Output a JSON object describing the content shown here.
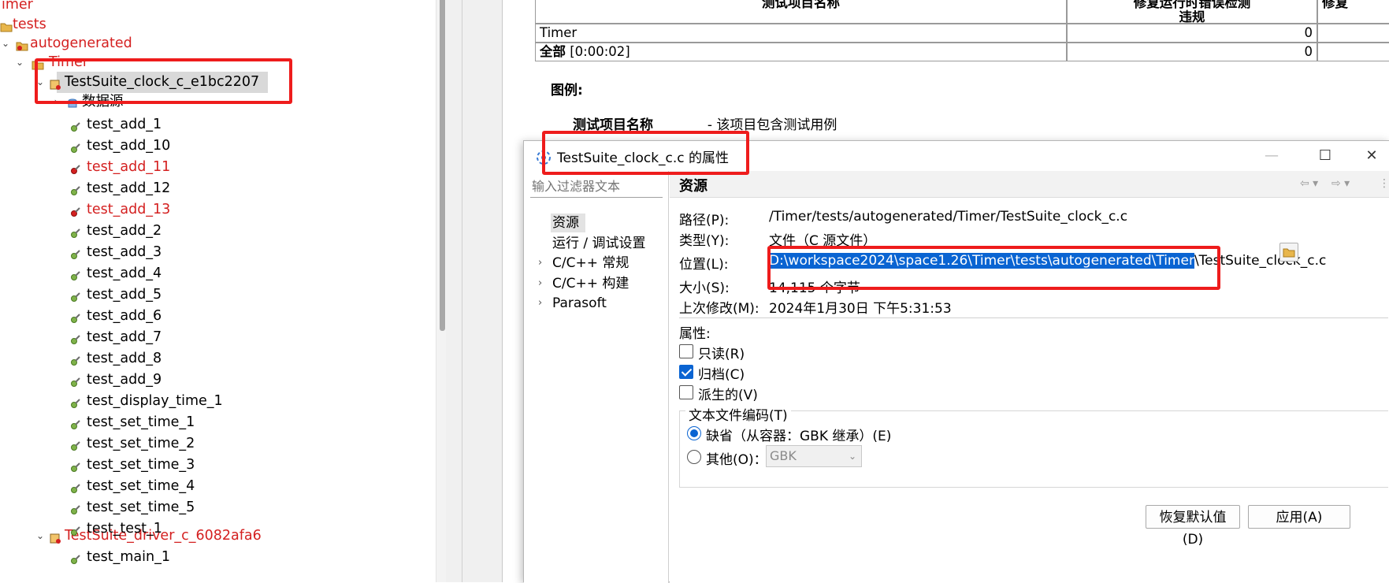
{
  "tree": {
    "items": [
      {
        "label": "imer",
        "red": true
      },
      {
        "label": "tests",
        "red": true
      },
      {
        "label": "autogenerated",
        "red": true
      },
      {
        "label": "Timer",
        "red": true
      },
      {
        "label": "TestSuite_clock_c_e1bc2207",
        "red": false
      },
      {
        "label": "数据源",
        "red": false
      },
      {
        "label": "test_add_1",
        "red": false
      },
      {
        "label": "test_add_10",
        "red": false
      },
      {
        "label": "test_add_11",
        "red": true
      },
      {
        "label": "test_add_12",
        "red": false
      },
      {
        "label": "test_add_13",
        "red": true
      },
      {
        "label": "test_add_2",
        "red": false
      },
      {
        "label": "test_add_3",
        "red": false
      },
      {
        "label": "test_add_4",
        "red": false
      },
      {
        "label": "test_add_5",
        "red": false
      },
      {
        "label": "test_add_6",
        "red": false
      },
      {
        "label": "test_add_7",
        "red": false
      },
      {
        "label": "test_add_8",
        "red": false
      },
      {
        "label": "test_add_9",
        "red": false
      },
      {
        "label": "test_display_time_1",
        "red": false
      },
      {
        "label": "test_set_time_1",
        "red": false
      },
      {
        "label": "test_set_time_2",
        "red": false
      },
      {
        "label": "test_set_time_3",
        "red": false
      },
      {
        "label": "test_set_time_4",
        "red": false
      },
      {
        "label": "test_set_time_5",
        "red": false
      },
      {
        "label": "test_test_1",
        "red": false
      },
      {
        "label": "TestSuite_driver_c_6082afa6",
        "red": true
      },
      {
        "label": "test_main_1",
        "red": false
      }
    ]
  },
  "report": {
    "col1_header": "测试项目名称",
    "col2_header_line1": "修复运行时错误检测",
    "col2_header_line2": "违规",
    "col3_header": "修复",
    "rows": [
      {
        "name": "Timer",
        "name_bold": "",
        "name_rest": "",
        "value": "0"
      },
      {
        "name": "",
        "name_bold": "全部",
        "name_rest": " [0:00:02]",
        "value": "0"
      }
    ],
    "legend_title": "图例:",
    "legend_term": "测试项目名称",
    "legend_desc": "- 该项目包含测试用例"
  },
  "dialog": {
    "title": "TestSuite_clock_c.c 的属性",
    "minimize": "—",
    "maximize": "☐",
    "close": "✕",
    "filter_placeholder": "输入过滤器文本",
    "nav": [
      {
        "label": "资源",
        "expandable": false,
        "selected": true
      },
      {
        "label": "运行 / 调试设置",
        "expandable": false,
        "selected": false
      },
      {
        "label": "C/C++ 常规",
        "expandable": true,
        "selected": false
      },
      {
        "label": "C/C++ 构建",
        "expandable": true,
        "selected": false
      },
      {
        "label": "Parasoft",
        "expandable": true,
        "selected": false
      }
    ],
    "section_title": "资源",
    "path_label": "路径(P):",
    "path_value": "/Timer/tests/autogenerated/Timer/TestSuite_clock_c.c",
    "type_label": "类型(Y):",
    "type_value": "文件（C 源文件）",
    "location_label": "位置(L):",
    "location_selected": "D:\\workspace2024\\space1.26\\Timer\\tests\\autogenerated\\Timer",
    "location_rest": "\\TestSuite_clock_c.c",
    "size_label": "大小(S):",
    "size_value": "14,115 个字节",
    "modified_label": "上次修改(M):",
    "modified_value": "2024年1月30日 下午5:31:53",
    "attributes_label": "属性:",
    "readonly_label": "只读(R)",
    "readonly_checked": false,
    "archive_label": "归档(C)",
    "archive_checked": true,
    "derived_label": "派生的(V)",
    "derived_checked": false,
    "encoding_title": "文本文件编码(T)",
    "encoding_default_label": "缺省（从容器：GBK 继承）(E)",
    "encoding_other_label": "其他(O)：",
    "encoding_other_value": "GBK",
    "restore_button": "恢复默认值(D)",
    "apply_button": "应用(A)"
  },
  "colors": {
    "annotation_red": "#ee1c1c",
    "selection_blue": "#0a64d2",
    "tree_red": "#d42020"
  }
}
